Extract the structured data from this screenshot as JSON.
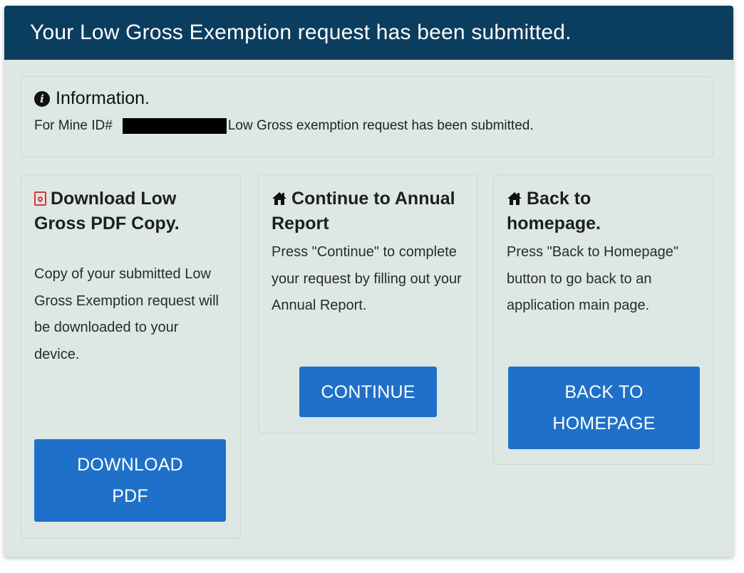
{
  "header": {
    "title": "Your Low Gross Exemption request has been submitted."
  },
  "info": {
    "title": "Information.",
    "prefix": "For Mine ID#",
    "suffix": "Low Gross exemption request has been submitted."
  },
  "cards": {
    "download": {
      "title": "Download Low Gross PDF Copy.",
      "body": "Copy of your submitted Low Gross Exemption request will be downloaded to your device.",
      "button": "DOWNLOAD PDF"
    },
    "continue": {
      "title": "Continue to Annual Report",
      "body": "Press \"Continue\" to complete your request by filling out your Annual Report.",
      "button": "CONTINUE"
    },
    "home": {
      "title": "Back to homepage.",
      "body": "Press \"Back to Homepage\" button to go back to an application main page.",
      "button": "BACK TO HOMEPAGE"
    }
  },
  "icons": {
    "info": "info-circle-icon",
    "pdf": "file-pdf-icon",
    "home": "home-icon"
  },
  "colors": {
    "header_bg": "#0b3d5e",
    "panel_bg": "#dde8e4",
    "button_bg": "#1f70c8",
    "pdf_icon": "#d93838"
  }
}
